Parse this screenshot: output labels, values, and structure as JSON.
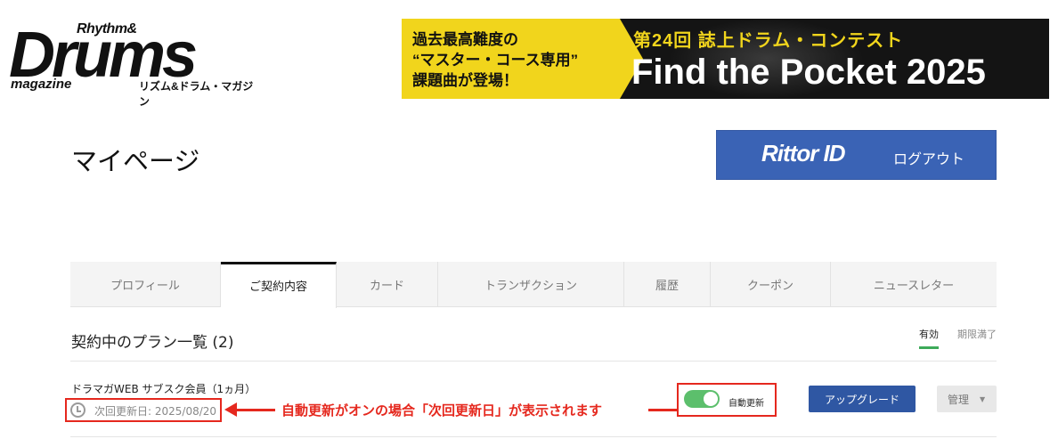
{
  "logo": {
    "rhythm": "Rhythm&",
    "drums": "Drums",
    "magazine": "magazine",
    "jp": "リズム&ドラム・マガジン"
  },
  "banner": {
    "left_line1": "過去最高難度の",
    "left_line2": "“マスター・コース専用”",
    "left_line3": "課題曲が登場！",
    "contest": "第24回 誌上ドラム・コンテスト",
    "title": "Find the Pocket 2025",
    "accent_color": "#f1d51c"
  },
  "page": {
    "title": "マイページ"
  },
  "logout": {
    "brand": "Rittor ID",
    "label": "ログアウト",
    "color": "#3a63b5"
  },
  "tabs": [
    {
      "label": "プロフィール",
      "active": false
    },
    {
      "label": "ご契約内容",
      "active": true
    },
    {
      "label": "カード",
      "active": false
    },
    {
      "label": "トランザクション",
      "active": false
    },
    {
      "label": "履歴",
      "active": false
    },
    {
      "label": "クーポン",
      "active": false
    },
    {
      "label": "ニュースレター",
      "active": false
    }
  ],
  "plans": {
    "heading": "契約中のプラン一覧 (2)",
    "filter_active": "有効",
    "filter_expired": "期限満了",
    "item": {
      "name": "ドラマガWEB サブスク会員（1ヵ月）",
      "renew_label": "次回更新日:",
      "renew_date": "2025/08/20",
      "auto_renew_label": "自動更新",
      "auto_renew_on": true,
      "upgrade_label": "アップグレード",
      "manage_label": "管理",
      "caret_icon": "chevron-down-icon"
    },
    "annotation": "自動更新がオンの場合「次回更新日」が表示されます",
    "annotation_color": "#e5281e"
  }
}
